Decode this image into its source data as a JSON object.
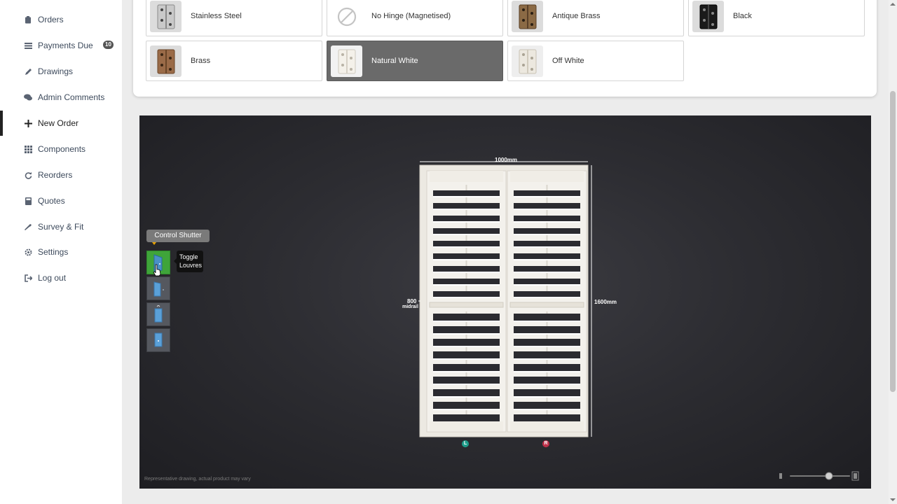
{
  "sidebar": {
    "items": [
      {
        "label": "Orders",
        "icon": "clipboard-icon"
      },
      {
        "label": "Payments Due",
        "icon": "money-stack-icon",
        "badge": "10"
      },
      {
        "label": "Drawings",
        "icon": "pencil-icon"
      },
      {
        "label": "Admin Comments",
        "icon": "comments-icon"
      },
      {
        "label": "New Order",
        "icon": "plus-icon",
        "active": true
      },
      {
        "label": "Components",
        "icon": "grid-icon"
      },
      {
        "label": "Reorders",
        "icon": "refresh-icon"
      },
      {
        "label": "Quotes",
        "icon": "calculator-icon"
      },
      {
        "label": "Survey & Fit",
        "icon": "wrench-icon"
      },
      {
        "label": "Settings",
        "icon": "gear-icon"
      },
      {
        "label": "Log out",
        "icon": "logout-icon"
      }
    ]
  },
  "hinge_options": [
    {
      "label": "Stainless Steel",
      "finish": "#c9c9c9"
    },
    {
      "label": "No Hinge (Magnetised)",
      "finish": "none"
    },
    {
      "label": "Antique Brass",
      "finish": "#8b6a45"
    },
    {
      "label": "Black",
      "finish": "#1a1a1a"
    },
    {
      "label": "Brass",
      "finish": "#9a6b48"
    },
    {
      "label": "Natural White",
      "finish": "#f4f1ea",
      "selected": true
    },
    {
      "label": "Off White",
      "finish": "#ece8df"
    }
  ],
  "viewer": {
    "control_title": "Control Shutter",
    "tooltip_line1": "Toggle",
    "tooltip_line2": "Louvres",
    "width_label": "1000mm",
    "height_label": "1600mm",
    "midrail_value": "800",
    "midrail_label": "midrail",
    "left_marker": "L",
    "right_marker": "R",
    "disclaimer": "Representative drawing, actual product may vary",
    "zoom_level": 0.65
  },
  "colors": {
    "active_green": "#3fa43a",
    "left_marker": "#1e9c8a",
    "right_marker": "#c0314a",
    "badge": "#555555"
  }
}
